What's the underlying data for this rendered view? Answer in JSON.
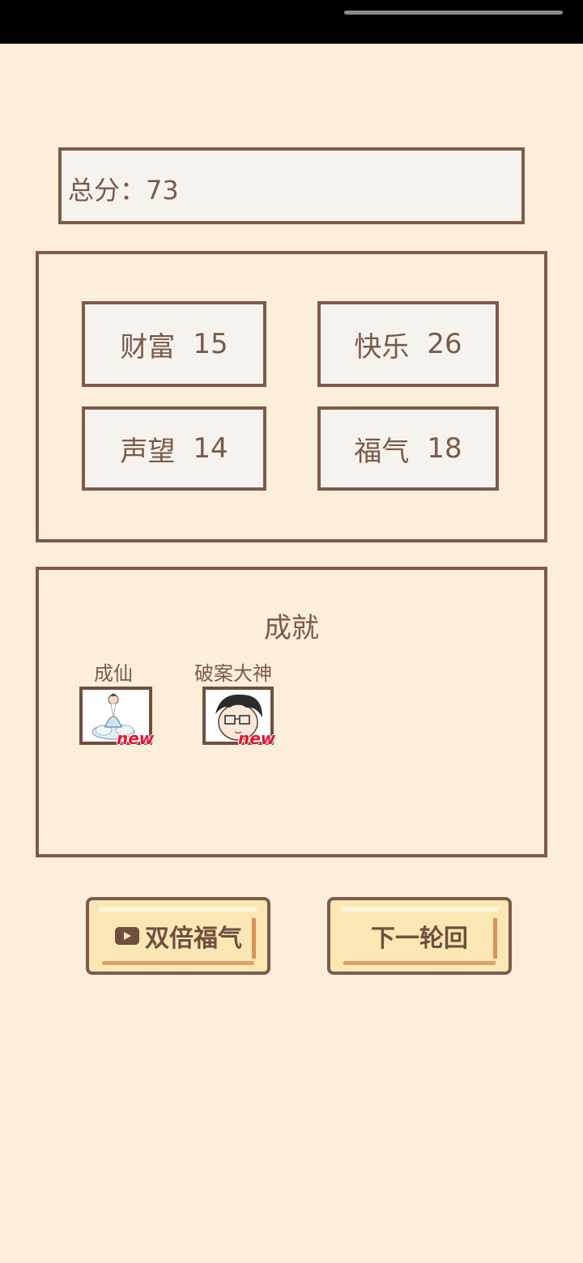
{
  "score": {
    "label": "总分：",
    "value": "73"
  },
  "stats": [
    {
      "name": "财富",
      "value": "15"
    },
    {
      "name": "快乐",
      "value": "26"
    },
    {
      "name": "声望",
      "value": "14"
    },
    {
      "name": "福气",
      "value": "18"
    }
  ],
  "achievements": {
    "title": "成就",
    "items": [
      {
        "name": "成仙",
        "badge": "new",
        "icon": "immortal-sage-icon"
      },
      {
        "name": "破案大神",
        "badge": "new",
        "icon": "detective-boy-icon"
      }
    ]
  },
  "buttons": {
    "double_luck": "双倍福气",
    "next_cycle": "下一轮回"
  },
  "colors": {
    "background": "#fdeedb",
    "panel": "#f6f3ef",
    "border": "#7e5a4a",
    "text": "#7a5a48",
    "button": "#fae7b3",
    "new_badge": "#e8132c"
  }
}
